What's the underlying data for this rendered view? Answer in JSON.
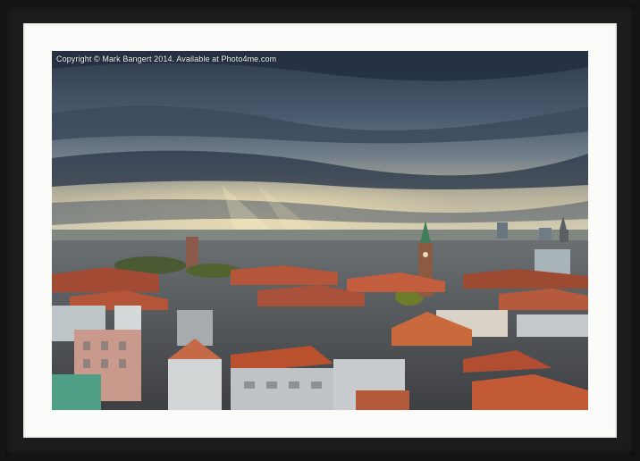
{
  "photo": {
    "copyright": "Copyright © Mark Bangert 2014. Available at Photo4me.com"
  },
  "colors": {
    "frame": "#141414",
    "mount": "#fbfbf9",
    "sky_dark": "#2b3644",
    "sky_light": "#c9c3a4",
    "roof_red": "#b8482c"
  }
}
